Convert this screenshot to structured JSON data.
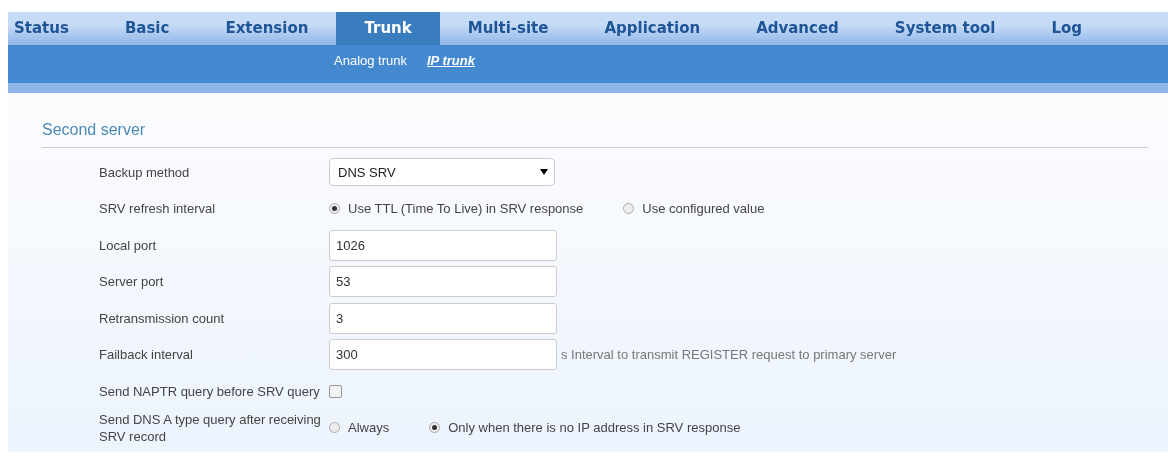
{
  "tabs": [
    {
      "label": "Status",
      "selected": false
    },
    {
      "label": "Basic",
      "selected": false
    },
    {
      "label": "Extension",
      "selected": false
    },
    {
      "label": "Trunk",
      "selected": true
    },
    {
      "label": "Multi-site",
      "selected": false
    },
    {
      "label": "Application",
      "selected": false
    },
    {
      "label": "Advanced",
      "selected": false
    },
    {
      "label": "System tool",
      "selected": false
    },
    {
      "label": "Log",
      "selected": false
    }
  ],
  "subtabs": [
    {
      "label": "Analog trunk",
      "selected": false
    },
    {
      "label": "IP trunk",
      "selected": true
    }
  ],
  "section": {
    "title": "Second server"
  },
  "fields": [
    {
      "kind": "select",
      "label": "Backup method",
      "value": "DNS SRV"
    },
    {
      "kind": "radio",
      "label": "SRV refresh interval",
      "options": [
        {
          "label": "Use TTL (Time To Live) in SRV response",
          "selected": true
        },
        {
          "label": "Use configured value",
          "selected": false
        }
      ]
    },
    {
      "kind": "text",
      "label": "Local port",
      "value": "1026"
    },
    {
      "kind": "text",
      "label": "Server port",
      "value": "53"
    },
    {
      "kind": "text",
      "label": "Retransmission count",
      "value": "3"
    },
    {
      "kind": "text",
      "label": "Failback interval",
      "value": "300",
      "hint": "s Interval to transmit REGISTER request to primary server"
    },
    {
      "kind": "checkbox",
      "label": "Send NAPTR query before SRV query",
      "checked": false
    },
    {
      "kind": "radio",
      "label": "Send DNS A type query after receiving SRV record",
      "options": [
        {
          "label": "Always",
          "selected": false
        },
        {
          "label": "Only when there is no IP address in SRV response",
          "selected": true
        }
      ]
    }
  ]
}
